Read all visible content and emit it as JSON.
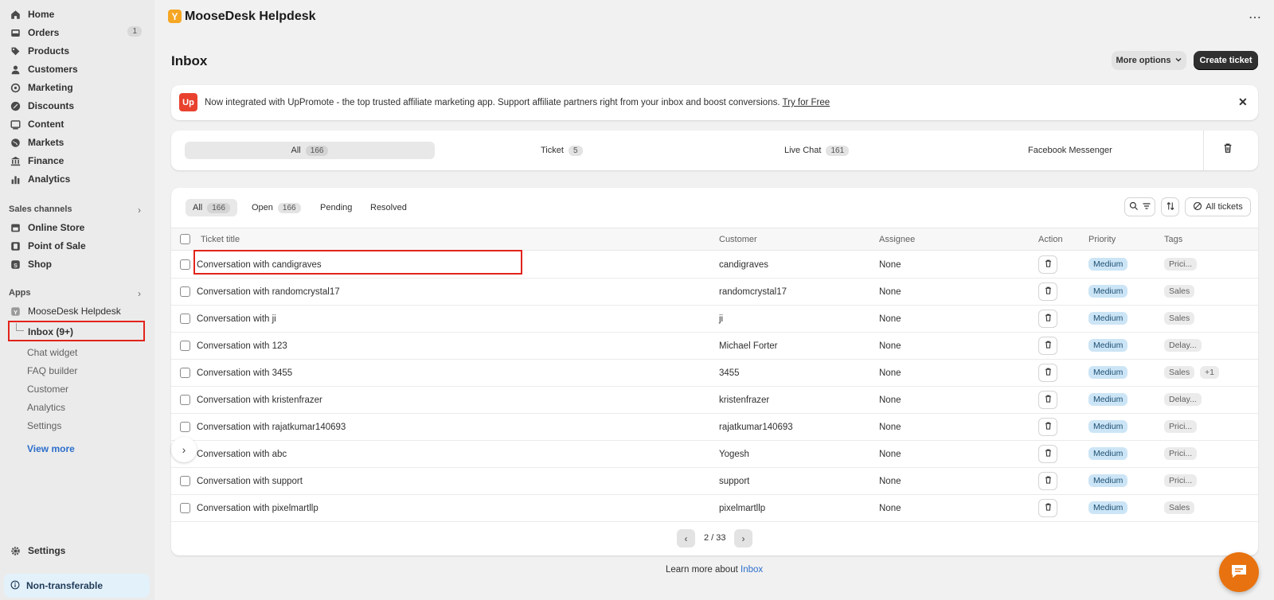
{
  "sidebar": {
    "main_items": [
      {
        "label": "Home",
        "icon": "home-icon"
      },
      {
        "label": "Orders",
        "icon": "orders-icon",
        "badge": "1"
      },
      {
        "label": "Products",
        "icon": "tag-icon"
      },
      {
        "label": "Customers",
        "icon": "person-icon"
      },
      {
        "label": "Marketing",
        "icon": "target-icon"
      },
      {
        "label": "Discounts",
        "icon": "discount-icon"
      },
      {
        "label": "Content",
        "icon": "content-icon"
      },
      {
        "label": "Markets",
        "icon": "globe-icon"
      },
      {
        "label": "Finance",
        "icon": "bank-icon"
      },
      {
        "label": "Analytics",
        "icon": "bar-chart-icon"
      }
    ],
    "sales_channels_title": "Sales channels",
    "sales_channels": [
      {
        "label": "Online Store",
        "icon": "store-icon"
      },
      {
        "label": "Point of Sale",
        "icon": "pos-icon"
      },
      {
        "label": "Shop",
        "icon": "shop-icon"
      }
    ],
    "apps_title": "Apps",
    "app_name": "MooseDesk Helpdesk",
    "inbox_label": "Inbox (9+)",
    "sub_items": [
      "Chat widget",
      "FAQ builder",
      "Customer",
      "Analytics",
      "Settings"
    ],
    "view_more": "View more",
    "settings": "Settings",
    "non_transferable": "Non-transferable"
  },
  "header": {
    "logo_letter": "Y",
    "app_title": "MooseDesk Helpdesk",
    "page_title": "Inbox",
    "more_options": "More options",
    "create_ticket": "Create ticket"
  },
  "banner": {
    "logo_text": "Up",
    "text": "Now integrated with UpPromote - the top trusted affiliate marketing app. Support affiliate partners right from your inbox and boost conversions.",
    "link": "Try for Free"
  },
  "channels": [
    {
      "label": "All",
      "count": "166"
    },
    {
      "label": "Ticket",
      "count": "5"
    },
    {
      "label": "Live Chat",
      "count": "161"
    },
    {
      "label": "Facebook Messenger",
      "count": ""
    }
  ],
  "filters": [
    {
      "label": "All",
      "count": "166"
    },
    {
      "label": "Open",
      "count": "166"
    },
    {
      "label": "Pending",
      "count": ""
    },
    {
      "label": "Resolved",
      "count": ""
    }
  ],
  "toolbar": {
    "all_tickets": "All tickets"
  },
  "columns": [
    "Ticket title",
    "Customer",
    "Assignee",
    "Action",
    "Priority",
    "Tags"
  ],
  "rows": [
    {
      "title": "Conversation with candigraves",
      "customer": "candigraves",
      "assignee": "None",
      "priority": "Medium",
      "tag": "Prici...",
      "extra": ""
    },
    {
      "title": "Conversation with randomcrystal17",
      "customer": "randomcrystal17",
      "assignee": "None",
      "priority": "Medium",
      "tag": "Sales",
      "extra": ""
    },
    {
      "title": "Conversation with ji",
      "customer": "ji",
      "assignee": "None",
      "priority": "Medium",
      "tag": "Sales",
      "extra": ""
    },
    {
      "title": "Conversation with 123",
      "customer": "Michael Forter",
      "assignee": "None",
      "priority": "Medium",
      "tag": "Delay...",
      "extra": ""
    },
    {
      "title": "Conversation with 3455",
      "customer": "3455",
      "assignee": "None",
      "priority": "Medium",
      "tag": "Sales",
      "extra": "+1"
    },
    {
      "title": "Conversation with kristenfrazer",
      "customer": "kristenfrazer",
      "assignee": "None",
      "priority": "Medium",
      "tag": "Delay...",
      "extra": ""
    },
    {
      "title": "Conversation with rajatkumar140693",
      "customer": "rajatkumar140693",
      "assignee": "None",
      "priority": "Medium",
      "tag": "Prici...",
      "extra": ""
    },
    {
      "title": "Conversation with abc",
      "customer": "Yogesh",
      "assignee": "None",
      "priority": "Medium",
      "tag": "Prici...",
      "extra": ""
    },
    {
      "title": "Conversation with support",
      "customer": "support",
      "assignee": "None",
      "priority": "Medium",
      "tag": "Prici...",
      "extra": ""
    },
    {
      "title": "Conversation with pixelmartllp",
      "customer": "pixelmartllp",
      "assignee": "None",
      "priority": "Medium",
      "tag": "Sales",
      "extra": ""
    }
  ],
  "pagination": {
    "text": "2 / 33"
  },
  "footer": {
    "learn_prefix": "Learn more about",
    "learn_link": "Inbox"
  },
  "colors": {
    "accent_dark": "#303030",
    "link_blue": "#2c6ecb",
    "highlight_red": "#e2231a",
    "chat_orange": "#e8720f",
    "priority_blue": "#cce5f6"
  }
}
